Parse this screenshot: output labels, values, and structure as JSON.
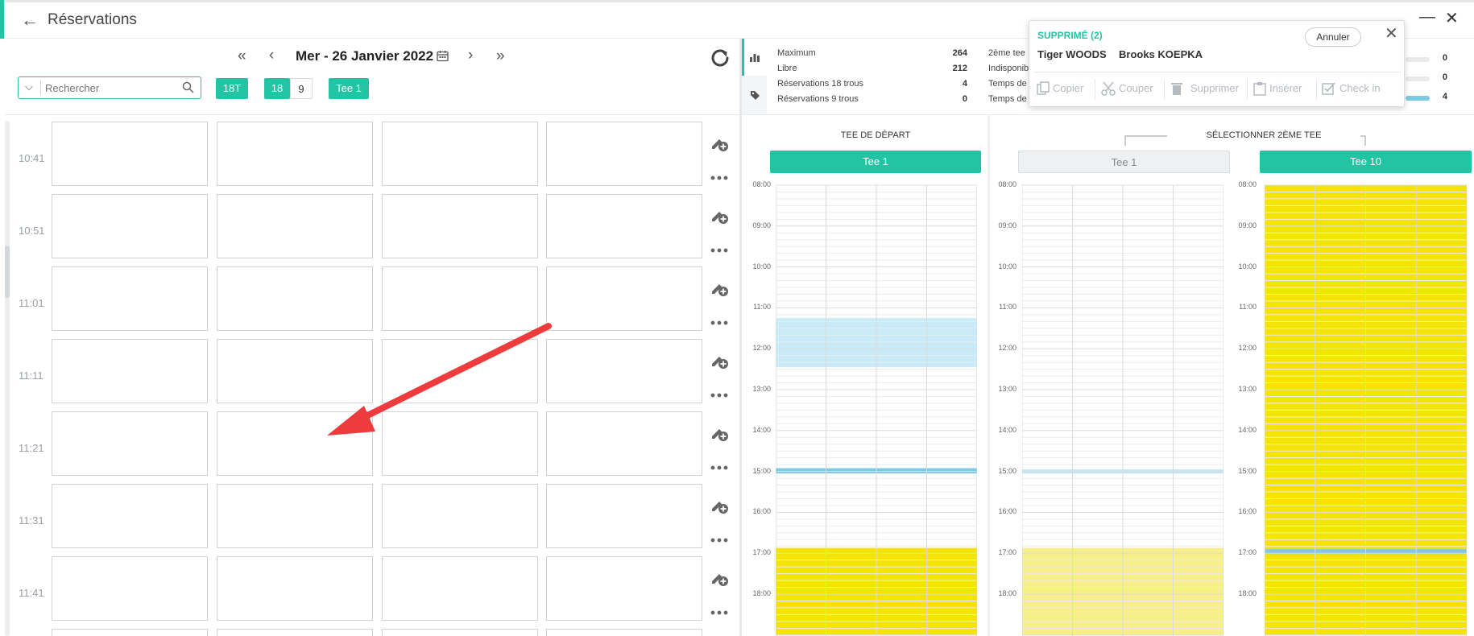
{
  "app": {
    "title": "Réservations",
    "back_icon": "arrow-left-icon",
    "accent_color": "#23c4a4"
  },
  "toolbar": {
    "date": "Mer - 26 Janvier 2022",
    "nav_first": "«",
    "nav_prev": "‹",
    "nav_next": "›",
    "nav_last": "»",
    "search_placeholder": "Rechercher",
    "btn_18t": "18T",
    "btn_18": "18",
    "btn_9": "9",
    "btn_tee1": "Tee 1"
  },
  "timeslots": [
    "10:41",
    "10:51",
    "11:01",
    "11:11",
    "11:21",
    "11:31",
    "11:41"
  ],
  "stats": [
    {
      "label": "Maximum",
      "value": "264"
    },
    {
      "label": "Libre",
      "value": "212"
    },
    {
      "label": "Réservations 18 trous",
      "value": "4"
    },
    {
      "label": "Réservations 9 trous",
      "value": "0"
    }
  ],
  "stats2_labels": [
    "2ème tee",
    "Indisponib",
    "Temps de",
    "Temps de"
  ],
  "stats3": [
    {
      "value": "0",
      "fill": 0
    },
    {
      "value": "0",
      "fill": 0
    },
    {
      "value": "4",
      "fill": 1.0
    }
  ],
  "tee_panel": {
    "start_header": "TEE DE DÉPART",
    "second_header": "SÉLECTIONNER 2ÈME TEE",
    "start_tee": "Tee 1",
    "second_tees": [
      "Tee 1",
      "Tee 10"
    ],
    "hours": [
      "08:00",
      "09:00",
      "10:00",
      "11:00",
      "12:00",
      "13:00",
      "14:00",
      "15:00",
      "16:00",
      "17:00",
      "18:00"
    ],
    "colors": {
      "yellow": "#f5e400",
      "pale_yellow": "#f8ef8a",
      "light_blue": "#c9ebf7",
      "blue": "#7ccbe3",
      "pale_blue": "#c3e6f3"
    }
  },
  "popup": {
    "title": "SUPPRIMÉ (2)",
    "names": [
      "Tiger WOODS",
      "Brooks KOEPKA"
    ],
    "annuler": "Annuler",
    "actions": [
      "Copier",
      "Couper",
      "Supprimer",
      "Insérer",
      "Check in"
    ]
  }
}
